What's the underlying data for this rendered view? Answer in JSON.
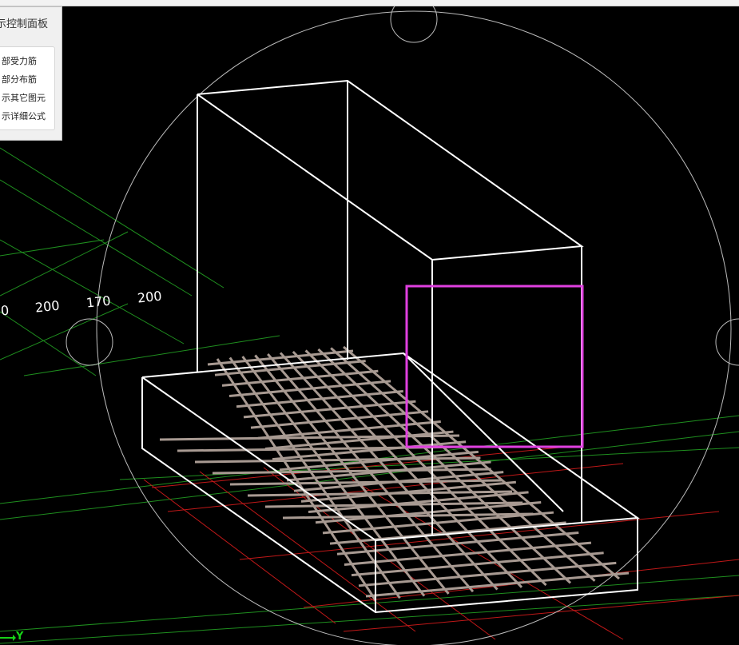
{
  "panel": {
    "title": "示控制面板",
    "options": [
      "部受力筋",
      "部分布筋",
      "示其它图元",
      "示详细公式"
    ]
  },
  "dimensions": [
    "0",
    "200",
    "170",
    "200"
  ],
  "axis": {
    "y_label": "Y"
  },
  "colors": {
    "background": "#000000",
    "wireframe": "#ffffff",
    "grid_green": "#1f8f1f",
    "grid_red": "#c01818",
    "rebar": "#a89a92",
    "selection": "#e040e0",
    "orbit_circle": "#bbbbbb"
  }
}
